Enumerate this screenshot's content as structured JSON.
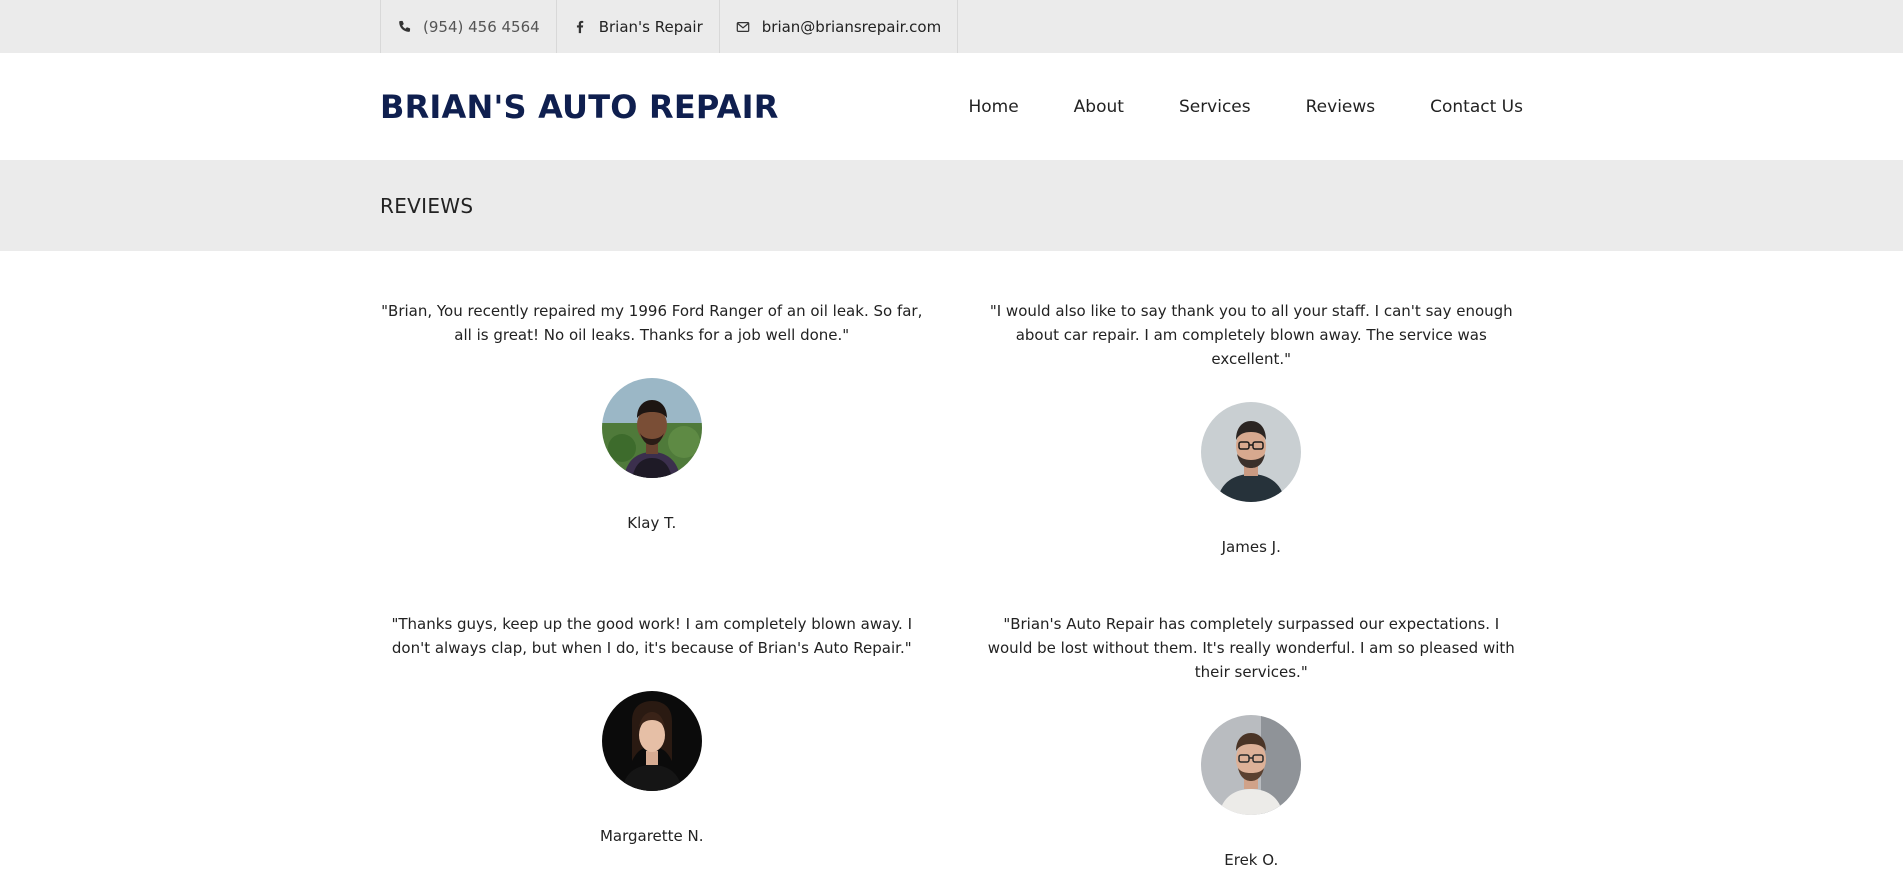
{
  "topbar": {
    "phone": {
      "icon": "phone-icon",
      "text": "(954) 456 4564"
    },
    "facebook": {
      "icon": "facebook-icon",
      "text": "Brian's Repair"
    },
    "email": {
      "icon": "envelope-icon",
      "text": "brian@briansrepair.com"
    }
  },
  "header": {
    "logo": "BRIAN'S AUTO REPAIR",
    "nav": [
      "Home",
      "About",
      "Services",
      "Reviews",
      "Contact Us"
    ]
  },
  "page": {
    "title": "REVIEWS"
  },
  "reviews": [
    {
      "quote": "\"Brian, You recently repaired my 1996 Ford Ranger of an oil leak. So far, all is great! No oil leaks. Thanks for a job well done.\"",
      "name": "Klay T."
    },
    {
      "quote": "\"I would also like to say thank you to all your staff. I can't say enough about car repair. I am completely blown away. The service was excellent.\"",
      "name": "James J."
    },
    {
      "quote": "\"Thanks guys, keep up the good work! I am completely blown away. I don't always clap, but when I do, it's because of Brian's Auto Repair.\"",
      "name": "Margarette N."
    },
    {
      "quote": "\"Brian's Auto Repair has completely surpassed our expectations. I would be lost without them. It's really wonderful. I am so pleased with their services.\"",
      "name": "Erek O."
    }
  ],
  "colors": {
    "brand": "#0f1f4f",
    "band": "#ebebeb"
  }
}
